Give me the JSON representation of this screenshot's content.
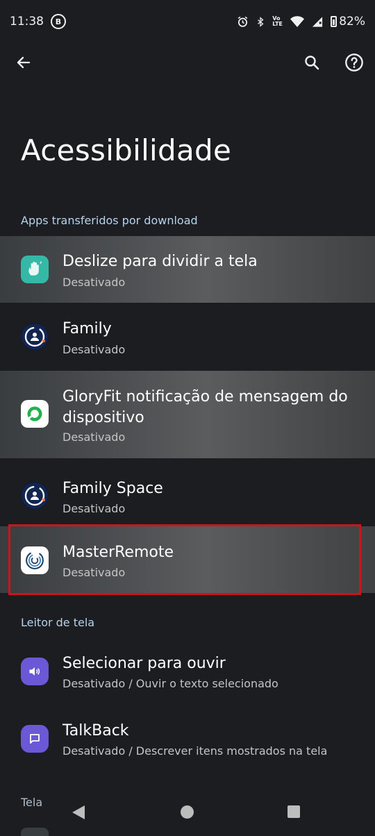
{
  "status_bar": {
    "time": "11:38",
    "notif_letter": "B",
    "battery": "82%",
    "volte": "Vo LTE"
  },
  "app_bar": {
    "back_icon": "arrow-back-icon",
    "search_icon": "search-icon",
    "help_icon": "help-icon"
  },
  "page": {
    "title": "Acessibilidade"
  },
  "sections": {
    "downloaded": "Apps transferidos por download",
    "screen_reader": "Leitor de tela",
    "screen": "Tela"
  },
  "items": [
    {
      "title": "Deslize para dividir a tela",
      "subtitle": "Desativado"
    },
    {
      "title": "Family",
      "subtitle": "Desativado"
    },
    {
      "title": "GloryFit notificação de mensagem do dispositivo",
      "subtitle": "Desativado"
    },
    {
      "title": "Family Space",
      "subtitle": "Desativado"
    },
    {
      "title": "MasterRemote",
      "subtitle": "Desativado"
    },
    {
      "title": "Selecionar para ouvir",
      "subtitle": "Desativado / Ouvir o texto selecionado"
    },
    {
      "title": "TalkBack",
      "subtitle": "Desativado / Descrever itens mostrados na tela"
    }
  ],
  "colors": {
    "background": "#1b1d20",
    "section_header": "#b7d3ec",
    "selection_outline": "#d0121a",
    "teal_icon": "#36b8a6",
    "purple_icon": "#6b58d6"
  }
}
